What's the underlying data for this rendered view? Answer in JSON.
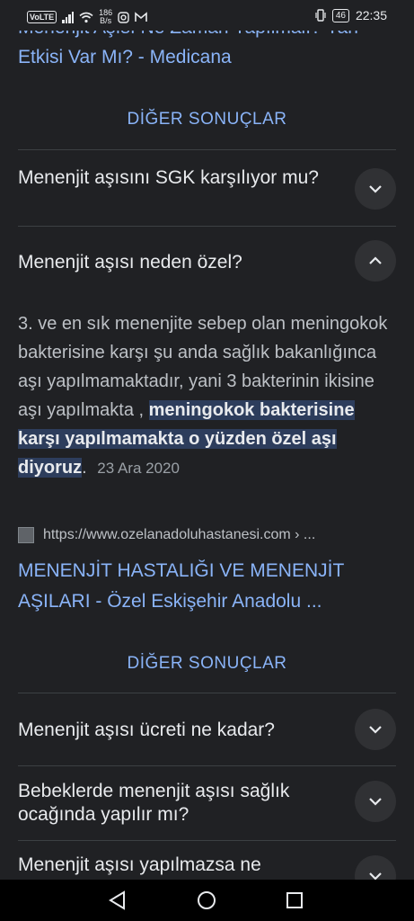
{
  "status_bar": {
    "network_type": "VoLTE",
    "speed_value": "186",
    "speed_unit": "B/s",
    "battery": "46",
    "time": "22:35"
  },
  "top_result": {
    "title_cut": "Menenjit Aşısı Ne Zaman Yapılmalı? Yan",
    "title_line2": "Etkisi Var Mı? - Medicana"
  },
  "more_results_label": "DİĞER SONUÇLAR",
  "faq_top": [
    {
      "question": "Menenjit aşısını SGK karşılıyor mu?",
      "expanded": false
    },
    {
      "question": "Menenjit aşısı neden özel?",
      "expanded": true
    }
  ],
  "answer": {
    "text_plain": "3. ve en sık menenjite sebep olan meningokok bakterisine karşı şu anda sağlık bakanlığınca aşı yapılmamaktadır, yani 3 bakterinin ikisine aşı yapılmakta ,",
    "text_highlight": "meningokok bakterisine karşı yapılmamakta o yüzden özel aşı diyoruz",
    "text_end": ".",
    "date": "23 Ara 2020"
  },
  "source": {
    "url": "https://www.ozelanadoluhastanesi.com › ...",
    "title": "MENENJİT HASTALIĞI VE MENENJİT AŞILARI - Özel Eskişehir Anadolu ..."
  },
  "more_results_label_2": "DİĞER SONUÇLAR",
  "faq_bottom": [
    {
      "question": "Menenjit aşısı ücreti ne kadar?",
      "expanded": false
    },
    {
      "question": "Bebeklerde menenjit aşısı sağlık ocağında yapılır mı?",
      "expanded": false
    },
    {
      "question": "Menenjit aşısı yapılmazsa ne",
      "expanded": false
    }
  ],
  "colors": {
    "background": "#202124",
    "link": "#8ab4f8",
    "text": "#e8eaed",
    "highlight": "#2d3d5c"
  },
  "icons": {
    "expand": "chevron-down-icon",
    "collapse": "chevron-up-icon",
    "back": "triangle-back-icon",
    "home": "circle-home-icon",
    "recents": "square-recents-icon"
  }
}
